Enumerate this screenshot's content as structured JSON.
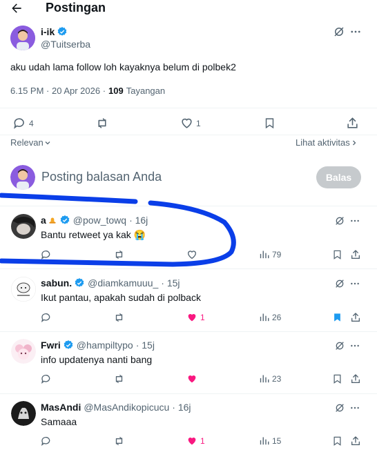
{
  "header": {
    "title": "Postingan"
  },
  "post": {
    "name": "i-ik",
    "handle": "@Tuitserba",
    "text": "aku udah lama follow loh kayaknya belum di polbek2",
    "time": "6.15 PM · 20 Apr 2026 ·",
    "views_count": "109",
    "views_label": "Tayangan",
    "reply_count": "4",
    "like_count": "1"
  },
  "sort": {
    "relevant_label": "Relevan",
    "activity_label": "Lihat aktivitas"
  },
  "composer": {
    "placeholder": "Posting balasan Anda",
    "reply_button": "Balas"
  },
  "replies": [
    {
      "name": "a",
      "handle": "@pow_towq",
      "time": "· 16j",
      "text": "Bantu retweet ya kak 😭",
      "likes": "",
      "views": "79",
      "liked": false,
      "bookmarked": false
    },
    {
      "name": "sabun.",
      "handle": "@diamkamuuu_",
      "time": "· 15j",
      "text": "Ikut pantau, apakah sudah di polback",
      "likes": "1",
      "views": "26",
      "liked": true,
      "bookmarked": true
    },
    {
      "name": "Fwri",
      "handle": "@hampiltypo",
      "time": "· 15j",
      "text": "info updatenya nanti bang",
      "likes": "",
      "views": "23",
      "liked": true,
      "bookmarked": false
    },
    {
      "name": "MasAndi",
      "handle": "@MasAndikopicucu",
      "time": "· 16j",
      "text": "Samaaa",
      "likes": "1",
      "views": "15",
      "liked": true,
      "bookmarked": false
    }
  ],
  "colors": {
    "accent": "#1d9bf0",
    "like": "#f91880",
    "annotation": "#0a3ee8"
  }
}
